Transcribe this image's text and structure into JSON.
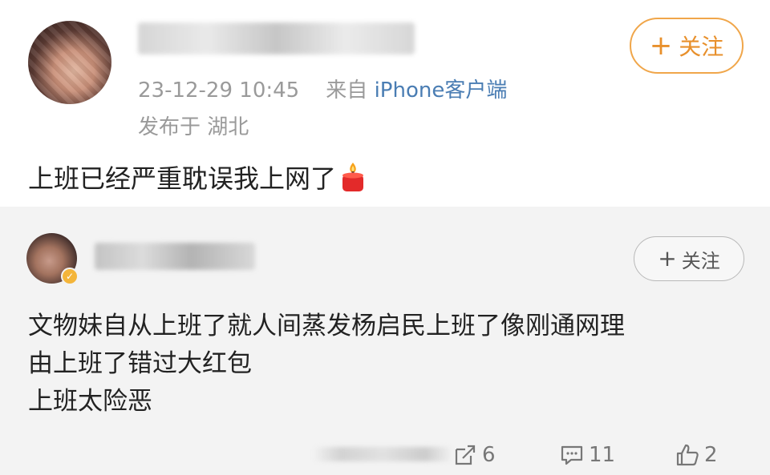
{
  "post": {
    "username_blurred": true,
    "timestamp": "23-12-29 10:45",
    "source_prefix": "来自",
    "source": "iPhone客户端",
    "location": "发布于 湖北",
    "follow_label": "关注",
    "content": "上班已经严重耽误我上网了",
    "emoji_icon": "candle-icon"
  },
  "reposted": {
    "username_blurred": true,
    "follow_label": "关注",
    "lines": [
      "文物妹自从上班了就人间蒸发杨启民上班了像刚通网理",
      "由上班了错过大红包",
      "上班太险恶"
    ],
    "actions": {
      "repost_count": "6",
      "comment_count": "11",
      "like_count": "2"
    }
  },
  "colors": {
    "follow_orange": "#e8902c",
    "link_blue": "#4a7db3",
    "meta_gray": "#9a9a9a",
    "card_bg": "#f3f3f3"
  }
}
